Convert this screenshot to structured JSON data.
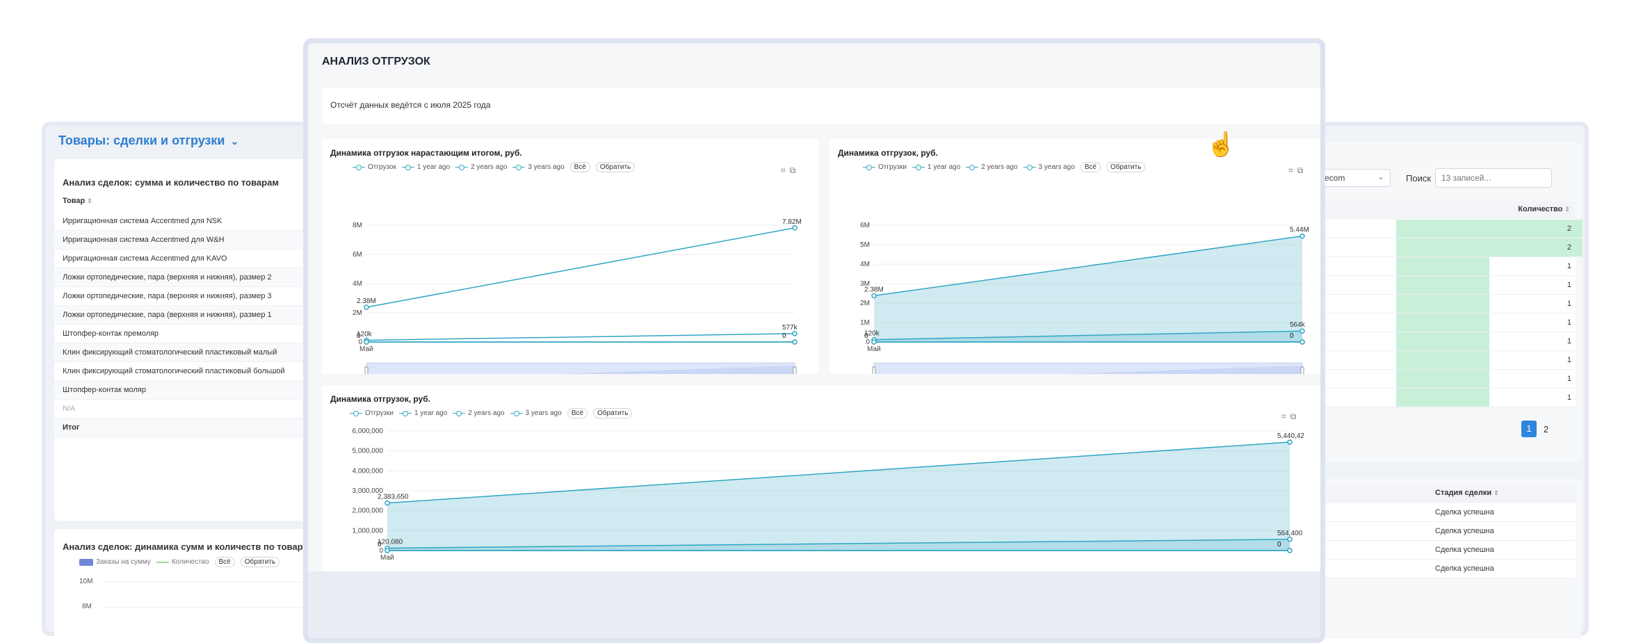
{
  "left_window": {
    "title": "Товары: сделки и отгрузки",
    "table_card": {
      "title": "Анализ сделок: сумма и количество по товарам",
      "column": "Товар",
      "rows": [
        "Ирригационная система Accentmed для NSK",
        "Ирригационная система Accentmed для W&H",
        "Ирригационная система Accentmed для KAVO",
        "Ложки ортопедические, пара (верхняя и нижняя), размер 2",
        "Ложки ортопедические, пара (верхняя и нижняя), размер 3",
        "Ложки ортопедические, пара (верхняя и нижняя), размер 1",
        "Штопфер-контак премоляр",
        "Клин фиксирующий стоматологический пластиковый малый",
        "Клин фиксирующий стоматологический пластиковый большой",
        "Штопфер-контак моляр",
        "N/A",
        "Итог"
      ]
    },
    "dynamics_card": {
      "title": "Анализ сделок: динамика сумм и количеств по товарам",
      "legend": [
        "Заказы на сумму",
        "Количество"
      ],
      "buttons": [
        "Всё",
        "Обратить"
      ],
      "y_ticks": [
        "10M",
        "8M"
      ]
    }
  },
  "right_window": {
    "select_value": "recom",
    "search_label": "Поиск",
    "search_placeholder": "13 записей...",
    "qty_header": "Количество",
    "qty_values": [
      "2",
      "2",
      "1",
      "1",
      "1",
      "1",
      "1",
      "1",
      "1",
      "1"
    ],
    "qty_fractions": [
      1,
      1,
      0.5,
      0.5,
      0.5,
      0.5,
      0.5,
      0.5,
      0.5,
      0.5
    ],
    "pages": [
      "1",
      "2"
    ],
    "stage_header": "Стадия сделки",
    "stage_values": [
      "Сделка успешна",
      "Сделка успешна",
      "Сделка успешна",
      "Сделка успешна"
    ]
  },
  "dialog": {
    "title": "АНАЛИЗ ОТГРУЗОК",
    "note": "Отсчёт данных ведётся с июля 2025 года",
    "legend": [
      "Отгрузок",
      "1 year ago",
      "2 years ago",
      "3 years ago"
    ],
    "legend_b": [
      "Отгрузки",
      "1 year ago",
      "2 years ago",
      "3 years ago"
    ],
    "buttons": [
      "Всё",
      "Обратить"
    ],
    "x_label": "Май"
  },
  "chart_data": [
    {
      "type": "line",
      "title": "Динамика отгрузок нарастающим итогом, руб.",
      "ylim": [
        0,
        8000000
      ],
      "y_ticks": [
        "8M",
        "6M",
        "4M",
        "2M",
        "0"
      ],
      "x_labels": [
        "Май"
      ],
      "series": [
        {
          "name": "Отгрузок",
          "values": [
            2380000,
            7820000
          ],
          "labels": [
            "2.38M",
            "7.82M"
          ]
        },
        {
          "name": "1 year ago",
          "values": [
            120000,
            577000
          ],
          "labels": [
            "120k",
            "577k"
          ]
        },
        {
          "name": "2 years ago",
          "values": [
            0,
            0
          ],
          "labels": [
            "0",
            "0"
          ]
        },
        {
          "name": "3 years ago",
          "values": [
            0,
            0
          ],
          "labels": [
            "0",
            "0"
          ]
        }
      ]
    },
    {
      "type": "area",
      "title": "Динамика отгрузок, руб.",
      "ylim": [
        0,
        6000000
      ],
      "y_ticks": [
        "6M",
        "5M",
        "4M",
        "3M",
        "2M",
        "1M",
        "0"
      ],
      "x_labels": [
        "Май"
      ],
      "series": [
        {
          "name": "Отгрузки",
          "values": [
            2380000,
            5440000
          ],
          "labels": [
            "2.38M",
            "5.44M"
          ]
        },
        {
          "name": "1 year ago",
          "values": [
            120000,
            564000
          ],
          "labels": [
            "120k",
            "564k"
          ]
        },
        {
          "name": "2 years ago",
          "values": [
            0,
            0
          ],
          "labels": [
            "0",
            "0"
          ]
        },
        {
          "name": "3 years ago",
          "values": [
            0,
            0
          ],
          "labels": [
            "0",
            "0"
          ]
        }
      ]
    },
    {
      "type": "area",
      "title": "Динамика отгрузок, руб.",
      "ylim": [
        0,
        6000000
      ],
      "y_ticks": [
        "6,000,000",
        "5,000,000",
        "4,000,000",
        "3,000,000",
        "2,000,000",
        "1,000,000",
        "0"
      ],
      "x_labels": [
        "Май"
      ],
      "series": [
        {
          "name": "Отгрузки",
          "values": [
            2383650,
            5440420
          ],
          "labels": [
            "2,383,650",
            "5,440,42"
          ]
        },
        {
          "name": "1 year ago",
          "values": [
            120080,
            564400
          ],
          "labels": [
            "120,080",
            "564,400"
          ]
        },
        {
          "name": "2 years ago",
          "values": [
            0,
            0
          ],
          "labels": [
            "0",
            "0"
          ]
        },
        {
          "name": "3 years ago",
          "values": [
            0,
            0
          ],
          "labels": [
            "0",
            "0"
          ]
        }
      ]
    }
  ]
}
